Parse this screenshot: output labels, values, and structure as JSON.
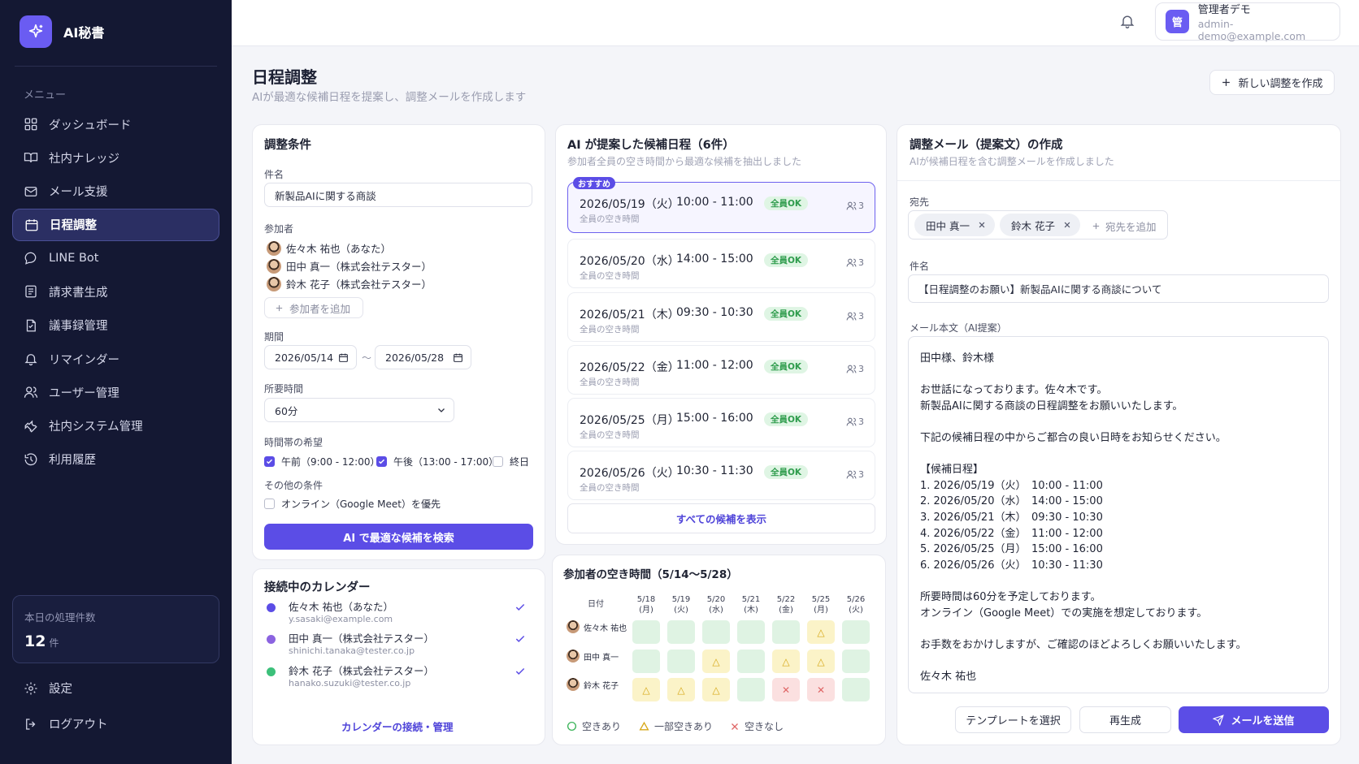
{
  "app": {
    "name": "AI秘書"
  },
  "sidebar": {
    "menu_label": "メニュー",
    "items": [
      {
        "label": "ダッシュボード",
        "icon": "dashboard-icon"
      },
      {
        "label": "社内ナレッジ",
        "icon": "book-icon"
      },
      {
        "label": "メール支援",
        "icon": "mail-icon"
      },
      {
        "label": "日程調整",
        "icon": "calendar-icon",
        "active": true
      },
      {
        "label": "LINE Bot",
        "icon": "chat-bubble-icon"
      },
      {
        "label": "請求書生成",
        "icon": "invoice-icon"
      },
      {
        "label": "議事録管理",
        "icon": "document-icon"
      },
      {
        "label": "リマインダー",
        "icon": "bell-icon"
      },
      {
        "label": "ユーザー管理",
        "icon": "users-icon"
      },
      {
        "label": "社内システム管理",
        "icon": "wrench-icon"
      },
      {
        "label": "利用履歴",
        "icon": "history-icon"
      }
    ],
    "stats": {
      "label": "本日の処理件数",
      "value": "12",
      "unit": "件"
    },
    "settings_label": "設定",
    "logout_label": "ログアウト"
  },
  "header": {
    "user": {
      "avatar_char": "管",
      "name": "管理者デモ",
      "email": "admin-demo@example.com"
    }
  },
  "page": {
    "title": "日程調整",
    "subtitle": "AIが最適な候補日程を提案し、調整メールを作成します",
    "new_button": "新しい調整を作成"
  },
  "conditions": {
    "title": "調整条件",
    "subject_label": "件名",
    "subject_value": "新製品AIに関する商談",
    "participants_label": "参加者",
    "participants": [
      "佐々木 祐也（あなた）",
      "田中 真一（株式会社テスター）",
      "鈴木 花子（株式会社テスター）"
    ],
    "add_participant": "参加者を追加",
    "period_label": "期間",
    "period_start": "2026/05/14",
    "period_sep": "〜",
    "period_end": "2026/05/28",
    "duration_label": "所要時間",
    "duration_value": "60分",
    "timeslot_label": "時間帯の希望",
    "timeslots": [
      {
        "label": "午前（9:00 - 12:00）",
        "checked": true
      },
      {
        "label": "午後（13:00 - 17:00）",
        "checked": true
      },
      {
        "label": "終日",
        "checked": false
      }
    ],
    "other_label": "その他の条件",
    "other_option": {
      "label": "オンライン（Google Meet）を優先",
      "checked": false
    },
    "search_button": "AI で最適な候補を検索"
  },
  "calendars": {
    "title": "接続中のカレンダー",
    "items": [
      {
        "name": "佐々木 祐也（あなた）",
        "email": "y.sasaki@example.com",
        "color": "#5b4de6"
      },
      {
        "name": "田中 真一（株式会社テスター）",
        "email": "shinichi.tanaka@tester.co.jp",
        "color": "#8b63e0"
      },
      {
        "name": "鈴木 花子（株式会社テスター）",
        "email": "hanako.suzuki@tester.co.jp",
        "color": "#3cc07a"
      }
    ],
    "manage_link": "カレンダーの接続・管理"
  },
  "candidates": {
    "title": "AI が提案した候補日程（6件）",
    "subtitle": "参加者全員の空き時間から最適な候補を抽出しました",
    "recommend_badge": "おすすめ",
    "items": [
      {
        "date": "2026/05/19（火）",
        "time": "10:00 - 11:00",
        "status": "全員OK",
        "sub": "全員の空き時間",
        "count": "3"
      },
      {
        "date": "2026/05/20（水）",
        "time": "14:00 - 15:00",
        "status": "全員OK",
        "sub": "全員の空き時間",
        "count": "3"
      },
      {
        "date": "2026/05/21（木）",
        "time": "09:30 - 10:30",
        "status": "全員OK",
        "sub": "全員の空き時間",
        "count": "3"
      },
      {
        "date": "2026/05/22（金）",
        "time": "11:00 - 12:00",
        "status": "全員OK",
        "sub": "全員の空き時間",
        "count": "3"
      },
      {
        "date": "2026/05/25（月）",
        "time": "15:00 - 16:00",
        "status": "全員OK",
        "sub": "全員の空き時間",
        "count": "3"
      },
      {
        "date": "2026/05/26（火）",
        "time": "10:30 - 11:30",
        "status": "全員OK",
        "sub": "全員の空き時間",
        "count": "3"
      }
    ],
    "show_all": "すべての候補を表示"
  },
  "availability": {
    "title": "参加者の空き時間（5/14〜5/28）",
    "date_header": "日付",
    "dates": [
      {
        "d": "5/18",
        "w": "(月)"
      },
      {
        "d": "5/19",
        "w": "(火)"
      },
      {
        "d": "5/20",
        "w": "(水)"
      },
      {
        "d": "5/21",
        "w": "(木)"
      },
      {
        "d": "5/22",
        "w": "(金)"
      },
      {
        "d": "5/25",
        "w": "(月)"
      },
      {
        "d": "5/26",
        "w": "(火)"
      }
    ],
    "rows": [
      {
        "name": "佐々木 祐也",
        "cells": [
          "g",
          "g",
          "g",
          "g",
          "g",
          "p",
          "g"
        ]
      },
      {
        "name": "田中 真一",
        "cells": [
          "g",
          "g",
          "p",
          "g",
          "p",
          "p",
          "g"
        ]
      },
      {
        "name": "鈴木 花子",
        "cells": [
          "p",
          "p",
          "p",
          "g",
          "n",
          "n",
          "g"
        ]
      }
    ],
    "legend": {
      "available": "空きあり",
      "partial": "一部空きあり",
      "busy": "空きなし"
    }
  },
  "email": {
    "title": "調整メール（提案文）の作成",
    "subtitle": "AIが候補日程を含む調整メールを作成しました",
    "to_label": "宛先",
    "recipients": [
      "田中 真一",
      "鈴木 花子"
    ],
    "add_recipient": "宛先を追加",
    "subject_label": "件名",
    "subject_value": "【日程調整のお願い】新製品AIに関する商談について",
    "body_label": "メール本文（AI提案）",
    "body_lines": [
      "田中様、鈴木様",
      "",
      "お世話になっております。佐々木です。",
      "新製品AIに関する商談の日程調整をお願いいたします。",
      "",
      "下記の候補日程の中からご都合の良い日時をお知らせください。",
      "",
      "【候補日程】",
      "1. 2026/05/19（火）　10:00 - 11:00",
      "2. 2026/05/20（水）　14:00 - 15:00",
      "3. 2026/05/21（木）　09:30 - 10:30",
      "4. 2026/05/22（金）　11:00 - 12:00",
      "5. 2026/05/25（月）　15:00 - 16:00",
      "6. 2026/05/26（火）　10:30 - 11:30",
      "",
      "所要時間は60分を予定しております。",
      "オンライン（Google Meet）での実施を想定しております。",
      "",
      "お手数をおかけしますが、ご確認のほどよろしくお願いいたします。",
      "",
      "佐々木 祐也"
    ],
    "template_button": "テンプレートを選択",
    "regenerate_button": "再生成",
    "send_button": "メールを送信"
  },
  "colors": {
    "accent": "#5b4de6",
    "sidebar_bg": "#141833",
    "ok_green": "#2e9c4c"
  }
}
